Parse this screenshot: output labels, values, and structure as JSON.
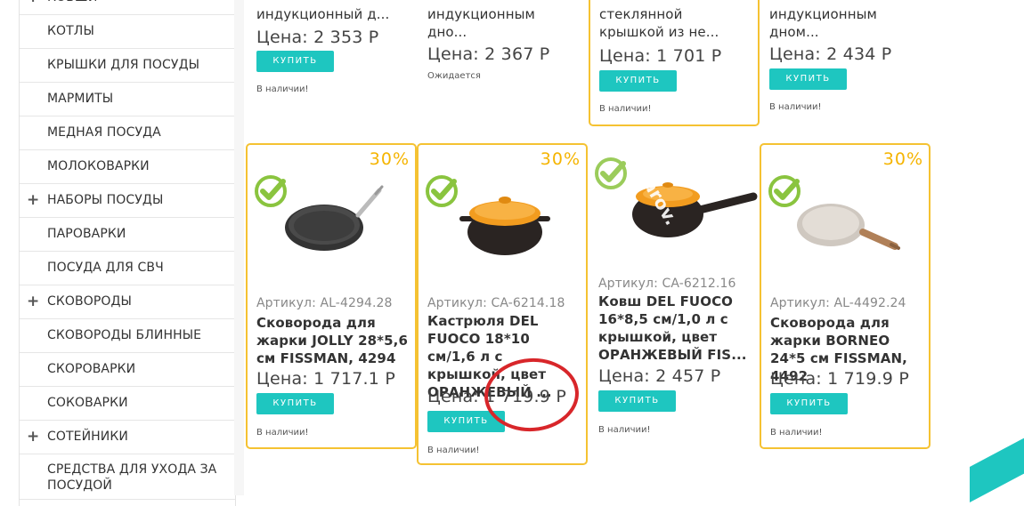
{
  "sidebar": {
    "items": [
      {
        "label": "Ковши",
        "expandable": true
      },
      {
        "label": "Котлы",
        "expandable": false
      },
      {
        "label": "Крышки для посуды",
        "expandable": false
      },
      {
        "label": "Мармиты",
        "expandable": false
      },
      {
        "label": "Медная посуда",
        "expandable": false
      },
      {
        "label": "Молоковарки",
        "expandable": false
      },
      {
        "label": "Наборы посуды",
        "expandable": true
      },
      {
        "label": "Пароварки",
        "expandable": false
      },
      {
        "label": "Посуда для СВЧ",
        "expandable": false
      },
      {
        "label": "Сковороды",
        "expandable": true
      },
      {
        "label": "Сковороды блинные",
        "expandable": false
      },
      {
        "label": "Скороварки",
        "expandable": false
      },
      {
        "label": "Соковарки",
        "expandable": false
      },
      {
        "label": "Сотейники",
        "expandable": true
      },
      {
        "label": "Средства для ухода за посудой",
        "expandable": false
      }
    ],
    "plus_icon": "+"
  },
  "colors": {
    "accent": "#1ec6c0",
    "highlight_border": "#f5c232",
    "discount": "#f5b400",
    "check_green": "#8ac43f",
    "annotation_circle": "#d8262a"
  },
  "products_top": [
    {
      "name_tail": "индукционный д...",
      "price": "Цена: 2 353",
      "currency": "Р",
      "button": "Купить",
      "stock": "В наличии!"
    },
    {
      "name_tail": "индукционным дно...",
      "price": "Цена: 2 367",
      "currency": "Р",
      "button": "",
      "stock": "Ожидается"
    },
    {
      "name_tail": "стеклянной крышкой из не...",
      "price": "Цена: 1 701",
      "currency": "Р",
      "button": "Купить",
      "stock": "В наличии!"
    },
    {
      "name_tail": "индукционным дном...",
      "price": "Цена: 2 434",
      "currency": "Р",
      "button": "Купить",
      "stock": "В наличии!"
    }
  ],
  "products_bottom": [
    {
      "discount": "30%",
      "sku": "Артикул: AL-4294.28",
      "name": "Сковорода для жарки JOLLY 28*5,6 см FISSMAN, 4294",
      "price": "Цена: 1 717.1",
      "currency": "Р",
      "button": "Купить",
      "stock": "В наличии!"
    },
    {
      "discount": "30%",
      "sku": "Артикул: CA-6214.18",
      "name": "Кастрюля DEL FUOCO 18*10 см/1,6 л с крышкой, цвет ОРАНЖЕВЫЙ ...",
      "price": "Цена: 1 719.9",
      "currency": "Р",
      "button": "Купить",
      "stock": "В наличии!"
    },
    {
      "discount": "",
      "sku": "Артикул: CA-6212.16",
      "name": "Ковш DEL FUOCO 16*8,5 см/1,0 л с крышкой, цвет ОРАНЖЕВЫЙ FIS...",
      "price": "Цена: 2 457",
      "currency": "Р",
      "button": "Купить",
      "stock": "В наличии!",
      "watermark": "arov."
    },
    {
      "discount": "30%",
      "sku": "Артикул: AL-4492.24",
      "name": "Сковорода для жарки BORNEO 24*5 см FISSMAN, 4492",
      "price": "Цена: 1 719.9",
      "currency": "Р",
      "button": "Купить",
      "stock": "В наличии!"
    }
  ]
}
